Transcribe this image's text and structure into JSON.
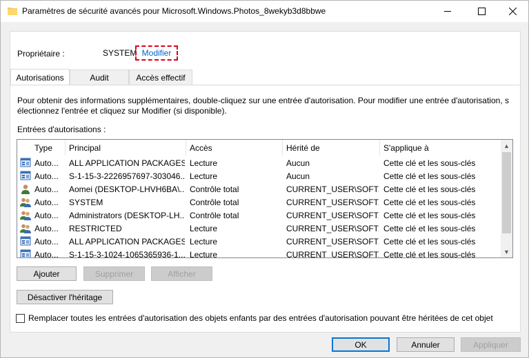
{
  "window": {
    "title": "Paramètres de sécurité avancés pour Microsoft.Windows.Photos_8wekyb3d8bbwe"
  },
  "owner": {
    "label": "Propriétaire :",
    "value": "SYSTEM",
    "modify_link": "Modifier"
  },
  "tabs": [
    {
      "label": "Autorisations",
      "active": true
    },
    {
      "label": "Audit",
      "active": false
    },
    {
      "label": "Accès effectif",
      "active": false
    }
  ],
  "info_text": "Pour obtenir des informations supplémentaires, double-cliquez sur une entrée d'autorisation. Pour modifier une entrée d'autorisation, s électionnez l'entrée et cliquez sur Modifier (si disponible).",
  "entries_label": "Entrées d'autorisations :",
  "table": {
    "headers": [
      "Type",
      "Principal",
      "Accès",
      "Hérité de",
      "S'applique à"
    ],
    "rows": [
      {
        "icon": "package-icon",
        "type": "Auto...",
        "principal": "ALL APPLICATION PACKAGES",
        "access": "Lecture",
        "inherited": "Aucun",
        "applies": "Cette clé et les sous-clés"
      },
      {
        "icon": "package-icon",
        "type": "Auto...",
        "principal": "S-1-15-3-2226957697-303046...",
        "access": "Lecture",
        "inherited": "Aucun",
        "applies": "Cette clé et les sous-clés"
      },
      {
        "icon": "user-icon",
        "type": "Auto...",
        "principal": "Aomei (DESKTOP-LHVH6BA\\...",
        "access": "Contrôle total",
        "inherited": "CURRENT_USER\\SOFT...",
        "applies": "Cette clé et les sous-clés"
      },
      {
        "icon": "group-icon",
        "type": "Auto...",
        "principal": "SYSTEM",
        "access": "Contrôle total",
        "inherited": "CURRENT_USER\\SOFT...",
        "applies": "Cette clé et les sous-clés"
      },
      {
        "icon": "group-icon",
        "type": "Auto...",
        "principal": "Administrators (DESKTOP-LH...",
        "access": "Contrôle total",
        "inherited": "CURRENT_USER\\SOFT...",
        "applies": "Cette clé et les sous-clés"
      },
      {
        "icon": "group-icon",
        "type": "Auto...",
        "principal": "RESTRICTED",
        "access": "Lecture",
        "inherited": "CURRENT_USER\\SOFT...",
        "applies": "Cette clé et les sous-clés"
      },
      {
        "icon": "package-icon",
        "type": "Auto...",
        "principal": "ALL APPLICATION PACKAGES",
        "access": "Lecture",
        "inherited": "CURRENT_USER\\SOFT...",
        "applies": "Cette clé et les sous-clés"
      },
      {
        "icon": "package-icon",
        "type": "Auto...",
        "principal": "S-1-15-3-1024-1065365936-1...",
        "access": "Lecture",
        "inherited": "CURRENT_USER\\SOFT...",
        "applies": "Cette clé et les sous-clés"
      }
    ]
  },
  "buttons": {
    "add": "Ajouter",
    "remove": "Supprimer",
    "view": "Afficher",
    "disable_inheritance": "Désactiver l'héritage",
    "ok": "OK",
    "cancel": "Annuler",
    "apply": "Appliquer"
  },
  "replace_checkbox": {
    "label": "Remplacer toutes les entrées d'autorisation des objets enfants par des entrées d'autorisation pouvant être héritées de cet objet",
    "checked": false
  },
  "colors": {
    "link": "#0066cc",
    "highlight_border": "#d9001b",
    "default_button_border": "#0078d7"
  }
}
